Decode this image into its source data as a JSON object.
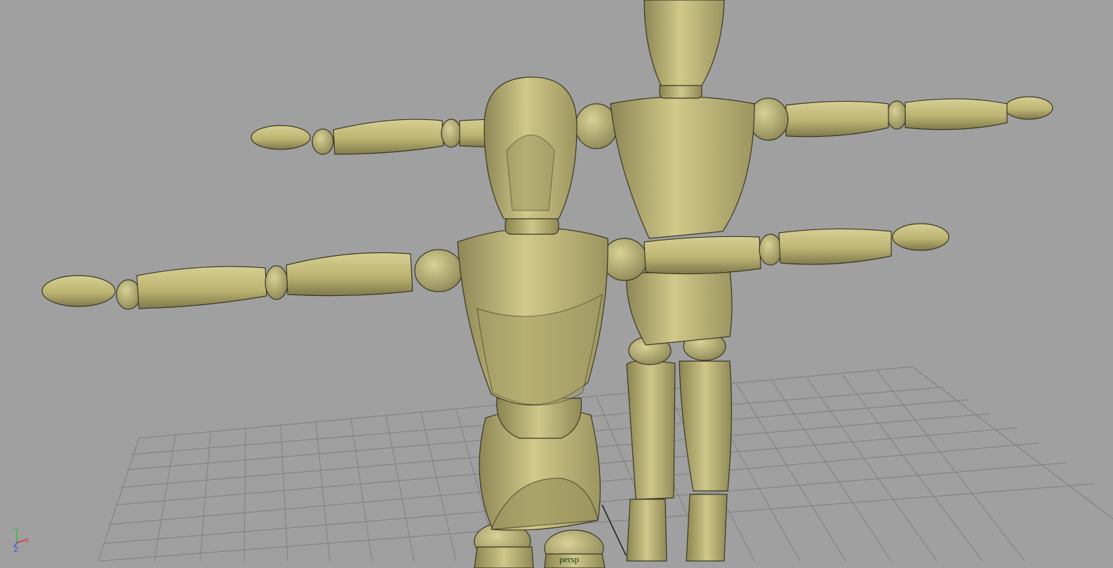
{
  "viewport": {
    "camera_name": "persp",
    "background_color": "#a0a0a0",
    "grid_color": "#7d7d7d",
    "mannequin_color": "#c8bf7c"
  },
  "axis_gizmo": {
    "x_label": "x",
    "y_label": "Y",
    "z_label": "Z",
    "x_color": "#e03030",
    "y_color": "#30c030",
    "z_color": "#3050e0"
  },
  "scene_objects": [
    "mannequin-back",
    "mannequin-front",
    "ground-grid"
  ]
}
